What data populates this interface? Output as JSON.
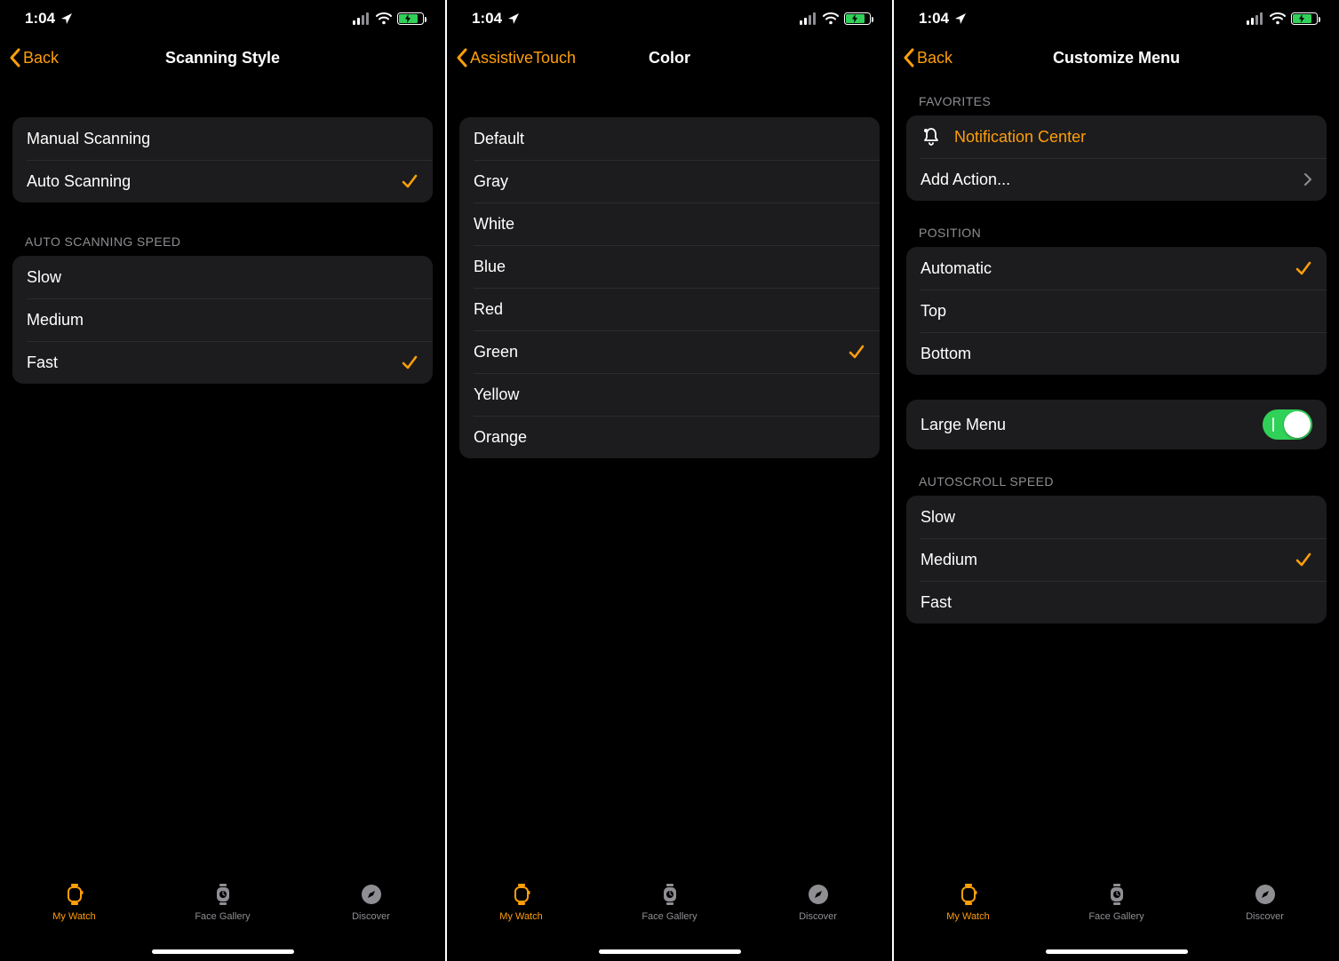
{
  "status": {
    "time": "1:04"
  },
  "tab_bar": {
    "my_watch": "My Watch",
    "face_gallery": "Face Gallery",
    "discover": "Discover"
  },
  "screen1": {
    "back_label": "Back",
    "title": "Scanning Style",
    "modes": [
      {
        "label": "Manual Scanning",
        "selected": false
      },
      {
        "label": "Auto Scanning",
        "selected": true
      }
    ],
    "speed_header": "AUTO SCANNING SPEED",
    "speeds": [
      {
        "label": "Slow",
        "selected": false
      },
      {
        "label": "Medium",
        "selected": false
      },
      {
        "label": "Fast",
        "selected": true
      }
    ]
  },
  "screen2": {
    "back_label": "AssistiveTouch",
    "title": "Color",
    "colors": [
      {
        "label": "Default",
        "selected": false
      },
      {
        "label": "Gray",
        "selected": false
      },
      {
        "label": "White",
        "selected": false
      },
      {
        "label": "Blue",
        "selected": false
      },
      {
        "label": "Red",
        "selected": false
      },
      {
        "label": "Green",
        "selected": true
      },
      {
        "label": "Yellow",
        "selected": false
      },
      {
        "label": "Orange",
        "selected": false
      }
    ]
  },
  "screen3": {
    "back_label": "Back",
    "title": "Customize Menu",
    "favorites_header": "FAVORITES",
    "favorites_item": "Notification Center",
    "add_action": "Add Action...",
    "position_header": "POSITION",
    "positions": [
      {
        "label": "Automatic",
        "selected": true
      },
      {
        "label": "Top",
        "selected": false
      },
      {
        "label": "Bottom",
        "selected": false
      }
    ],
    "large_menu_label": "Large Menu",
    "large_menu_on": true,
    "autoscroll_header": "AUTOSCROLL SPEED",
    "autoscroll": [
      {
        "label": "Slow",
        "selected": false
      },
      {
        "label": "Medium",
        "selected": true
      },
      {
        "label": "Fast",
        "selected": false
      }
    ]
  }
}
